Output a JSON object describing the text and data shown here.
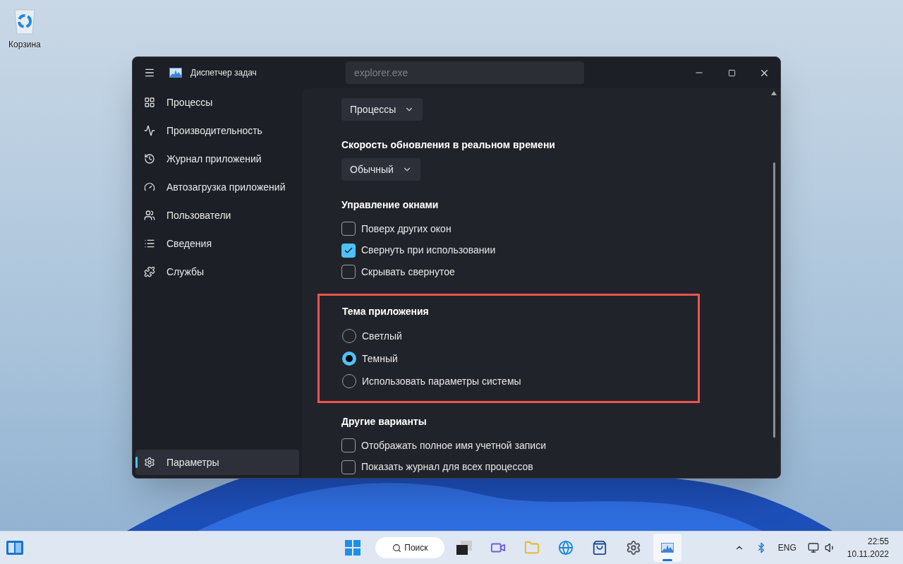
{
  "desktop_icons": [
    {
      "label": "Корзина"
    }
  ],
  "window": {
    "title": "Диспетчер задач",
    "search": {
      "placeholder": "explorer.exe"
    }
  },
  "sidebar": {
    "items": [
      {
        "label": "Процессы",
        "selected": false
      },
      {
        "label": "Производительность",
        "selected": false
      },
      {
        "label": "Журнал приложений",
        "selected": false
      },
      {
        "label": "Автозагрузка приложений",
        "selected": false
      },
      {
        "label": "Пользователи",
        "selected": false
      },
      {
        "label": "Сведения",
        "selected": false
      },
      {
        "label": "Службы",
        "selected": false
      }
    ],
    "footer": {
      "label": "Параметры",
      "selected": true
    }
  },
  "settings": [
    {
      "kind": "dropdown",
      "value": "Процессы"
    },
    {
      "kind": "section",
      "title": "Скорость обновления в реальном времени"
    },
    {
      "kind": "dropdown",
      "value": "Обычный"
    },
    {
      "kind": "section",
      "title": "Управление окнами"
    },
    {
      "kind": "checkbox",
      "label": "Поверх других окон",
      "checked": false
    },
    {
      "kind": "checkbox",
      "label": "Свернуть при использовании",
      "checked": true
    },
    {
      "kind": "checkbox",
      "label": "Скрывать свернутое",
      "checked": false
    }
  ],
  "theme": {
    "title": "Тема приложения",
    "highlighted": true,
    "options": [
      {
        "label": "Светлый",
        "selected": false
      },
      {
        "label": "Темный",
        "selected": true
      },
      {
        "label": "Использовать параметры системы",
        "selected": false
      }
    ]
  },
  "other": {
    "title": "Другие варианты",
    "options": [
      {
        "label": "Отображать полное имя учетной записи",
        "checked": false
      },
      {
        "label": "Показать журнал для всех процессов",
        "checked": false
      }
    ]
  },
  "taskbar": {
    "search": "Поиск",
    "apps": [
      {
        "active": false
      },
      {
        "active": false
      },
      {
        "active": false
      },
      {
        "active": false
      },
      {
        "active": false
      },
      {
        "active": false
      },
      {
        "active": true
      }
    ],
    "language": "ENG",
    "time": "22:55",
    "date": "10.11.2022"
  }
}
